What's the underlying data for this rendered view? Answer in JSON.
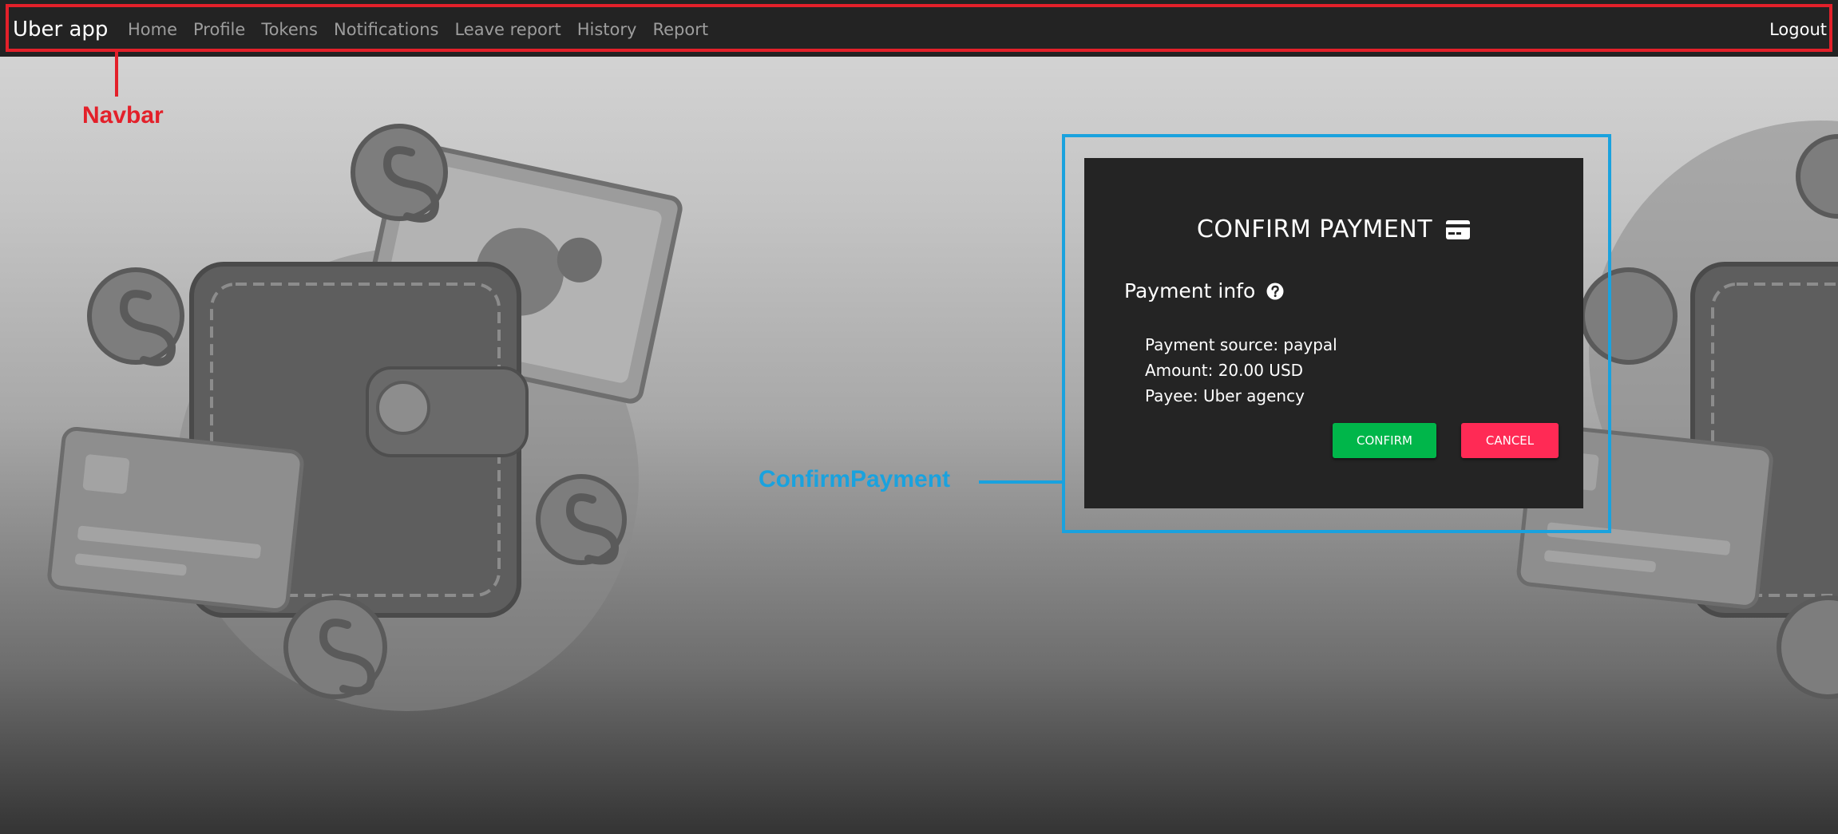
{
  "navbar": {
    "brand": "Uber app",
    "links": [
      "Home",
      "Profile",
      "Tokens",
      "Notifications",
      "Leave report",
      "History",
      "Report"
    ],
    "logout": "Logout"
  },
  "annotations": {
    "navbar": "Navbar",
    "confirm_payment": "ConfirmPayment"
  },
  "modal": {
    "title": "CONFIRM PAYMENT",
    "section_title": "Payment info",
    "info": [
      "Payment source: paypal",
      "Amount: 20.00 USD",
      "Payee: Uber agency"
    ],
    "confirm_label": "CONFIRM",
    "cancel_label": "CANCEL"
  },
  "colors": {
    "navbar_bg": "#232323",
    "modal_bg": "#242424",
    "confirm_button": "#00b64a",
    "cancel_button": "#ff2a55",
    "annotation_red": "#e3202a",
    "annotation_blue": "#1aa2de"
  },
  "icons": {
    "title_icon": "credit-card-icon",
    "section_icon": "question-circle-icon"
  }
}
